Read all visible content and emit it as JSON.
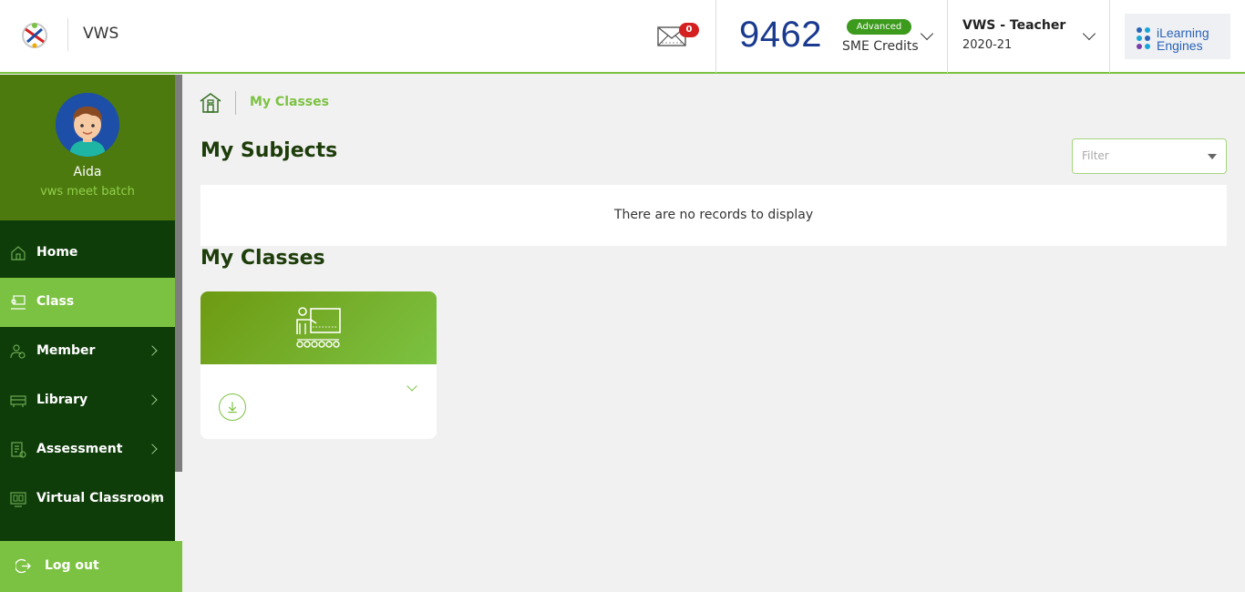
{
  "header": {
    "app_title": "VWS",
    "mail_count": "0",
    "credits": "9462",
    "plan_badge": "Advanced",
    "credits_label": "SME Credits",
    "role": "VWS - Teacher",
    "year": "2020-21",
    "brand_line1": "iLearning",
    "brand_line2": "Engines"
  },
  "user": {
    "name": "Aida",
    "batch": "vws meet batch"
  },
  "sidebar": {
    "items": [
      {
        "label": "Home",
        "icon": "home-icon",
        "active": false,
        "has_children": false
      },
      {
        "label": "Class",
        "icon": "class-icon",
        "active": true,
        "has_children": false
      },
      {
        "label": "Member",
        "icon": "member-icon",
        "active": false,
        "has_children": true
      },
      {
        "label": "Library",
        "icon": "library-icon",
        "active": false,
        "has_children": true
      },
      {
        "label": "Assessment",
        "icon": "assessment-icon",
        "active": false,
        "has_children": true
      },
      {
        "label": "Virtual Classroom",
        "icon": "virtual-classroom-icon",
        "active": false,
        "has_children": true
      }
    ],
    "logout_label": "Log out"
  },
  "breadcrumb": {
    "current": "My Classes"
  },
  "subjects": {
    "heading": "My Subjects",
    "filter_placeholder": "Filter",
    "empty_message": "There are no records to display"
  },
  "classes": {
    "heading": "My Classes"
  },
  "colors": {
    "accent": "#7cc242",
    "sidebar_dark": "#0f3d0a",
    "profile_bg": "#4d7a0e",
    "credits_blue": "#1a3a8f",
    "badge_red": "#d42020",
    "badge_green": "#3c9a1d"
  }
}
